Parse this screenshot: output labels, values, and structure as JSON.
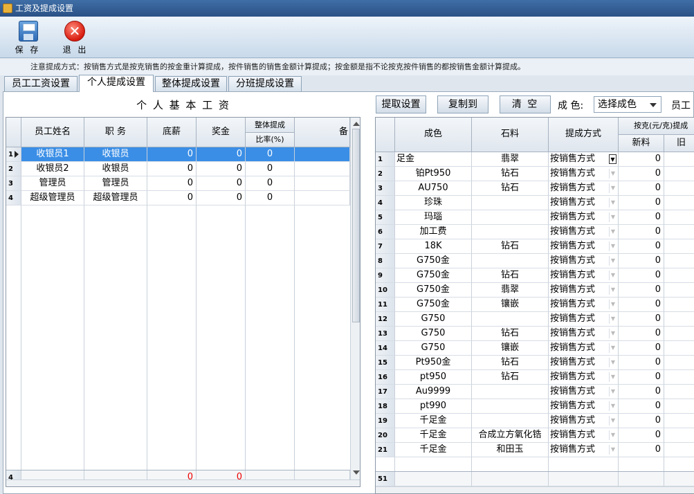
{
  "window": {
    "title": "工资及提成设置"
  },
  "toolbar": {
    "save_label": "保 存",
    "exit_label": "退 出"
  },
  "notice": "注意提成方式：按销售方式是按克销售的按金重计算提成，按件销售的销售金额计算提成；按金额是指不论按克按件销售的都按销售金额计算提成。",
  "tabs": [
    "员工工资设置",
    "个人提成设置",
    "整体提成设置",
    "分班提成设置"
  ],
  "active_tab": "个人提成设置",
  "left": {
    "title": "个 人 基 本 工 资",
    "headers": {
      "name": "员工姓名",
      "role": "职 务",
      "base": "底薪",
      "bonus": "奖金",
      "ratio_top": "整体提成",
      "ratio_bottom": "比率(%)",
      "remark": "备"
    },
    "rows": [
      {
        "no": "1",
        "name": "收银员1",
        "role": "收银员",
        "base": "0",
        "bonus": "0",
        "ratio": "0"
      },
      {
        "no": "2",
        "name": "收银员2",
        "role": "收银员",
        "base": "0",
        "bonus": "0",
        "ratio": "0"
      },
      {
        "no": "3",
        "name": "管理员",
        "role": "管理员",
        "base": "0",
        "bonus": "0",
        "ratio": "0"
      },
      {
        "no": "4",
        "name": "超级管理员",
        "role": "超级管理员",
        "base": "0",
        "bonus": "0",
        "ratio": "0"
      }
    ],
    "footer": {
      "count": "4",
      "base_total": "0",
      "bonus_total": "0"
    }
  },
  "right": {
    "buttons": {
      "extract": "提取设置",
      "copy": "复制到",
      "clear": "清 空"
    },
    "color_label": "成 色:",
    "color_select": "选择成色",
    "staff_label": "员工",
    "headers": {
      "color": "成色",
      "stone": "石料",
      "method": "提成方式",
      "per_gram_top": "按克(元/克)提成",
      "new": "新料",
      "old": "旧"
    },
    "rows": [
      {
        "no": "1",
        "color": "足金",
        "stone": "翡翠",
        "method": "按销售方式",
        "val": "0"
      },
      {
        "no": "2",
        "color": "铂Pt950",
        "stone": "钻石",
        "method": "按销售方式",
        "val": "0"
      },
      {
        "no": "3",
        "color": "AU750",
        "stone": "钻石",
        "method": "按销售方式",
        "val": "0"
      },
      {
        "no": "4",
        "color": "珍珠",
        "stone": "",
        "method": "按销售方式",
        "val": "0"
      },
      {
        "no": "5",
        "color": "玛瑙",
        "stone": "",
        "method": "按销售方式",
        "val": "0"
      },
      {
        "no": "6",
        "color": "加工费",
        "stone": "",
        "method": "按销售方式",
        "val": "0"
      },
      {
        "no": "7",
        "color": "18K",
        "stone": "钻石",
        "method": "按销售方式",
        "val": "0"
      },
      {
        "no": "8",
        "color": "G750金",
        "stone": "",
        "method": "按销售方式",
        "val": "0"
      },
      {
        "no": "9",
        "color": "G750金",
        "stone": "钻石",
        "method": "按销售方式",
        "val": "0"
      },
      {
        "no": "10",
        "color": "G750金",
        "stone": "翡翠",
        "method": "按销售方式",
        "val": "0"
      },
      {
        "no": "11",
        "color": "G750金",
        "stone": "镶嵌",
        "method": "按销售方式",
        "val": "0"
      },
      {
        "no": "12",
        "color": "G750",
        "stone": "",
        "method": "按销售方式",
        "val": "0"
      },
      {
        "no": "13",
        "color": "G750",
        "stone": "钻石",
        "method": "按销售方式",
        "val": "0"
      },
      {
        "no": "14",
        "color": "G750",
        "stone": "镶嵌",
        "method": "按销售方式",
        "val": "0"
      },
      {
        "no": "15",
        "color": "Pt950金",
        "stone": "钻石",
        "method": "按销售方式",
        "val": "0"
      },
      {
        "no": "16",
        "color": "pt950",
        "stone": "钻石",
        "method": "按销售方式",
        "val": "0"
      },
      {
        "no": "17",
        "color": "Au9999",
        "stone": "",
        "method": "按销售方式",
        "val": "0"
      },
      {
        "no": "18",
        "color": "pt990",
        "stone": "",
        "method": "按销售方式",
        "val": "0"
      },
      {
        "no": "19",
        "color": "千足金",
        "stone": "",
        "method": "按销售方式",
        "val": "0"
      },
      {
        "no": "20",
        "color": "千足金",
        "stone": "合成立方氧化锆",
        "method": "按销售方式",
        "val": "0"
      },
      {
        "no": "21",
        "color": "千足金",
        "stone": "和田玉",
        "method": "按销售方式",
        "val": "0"
      }
    ],
    "footer": {
      "count": "51"
    }
  }
}
